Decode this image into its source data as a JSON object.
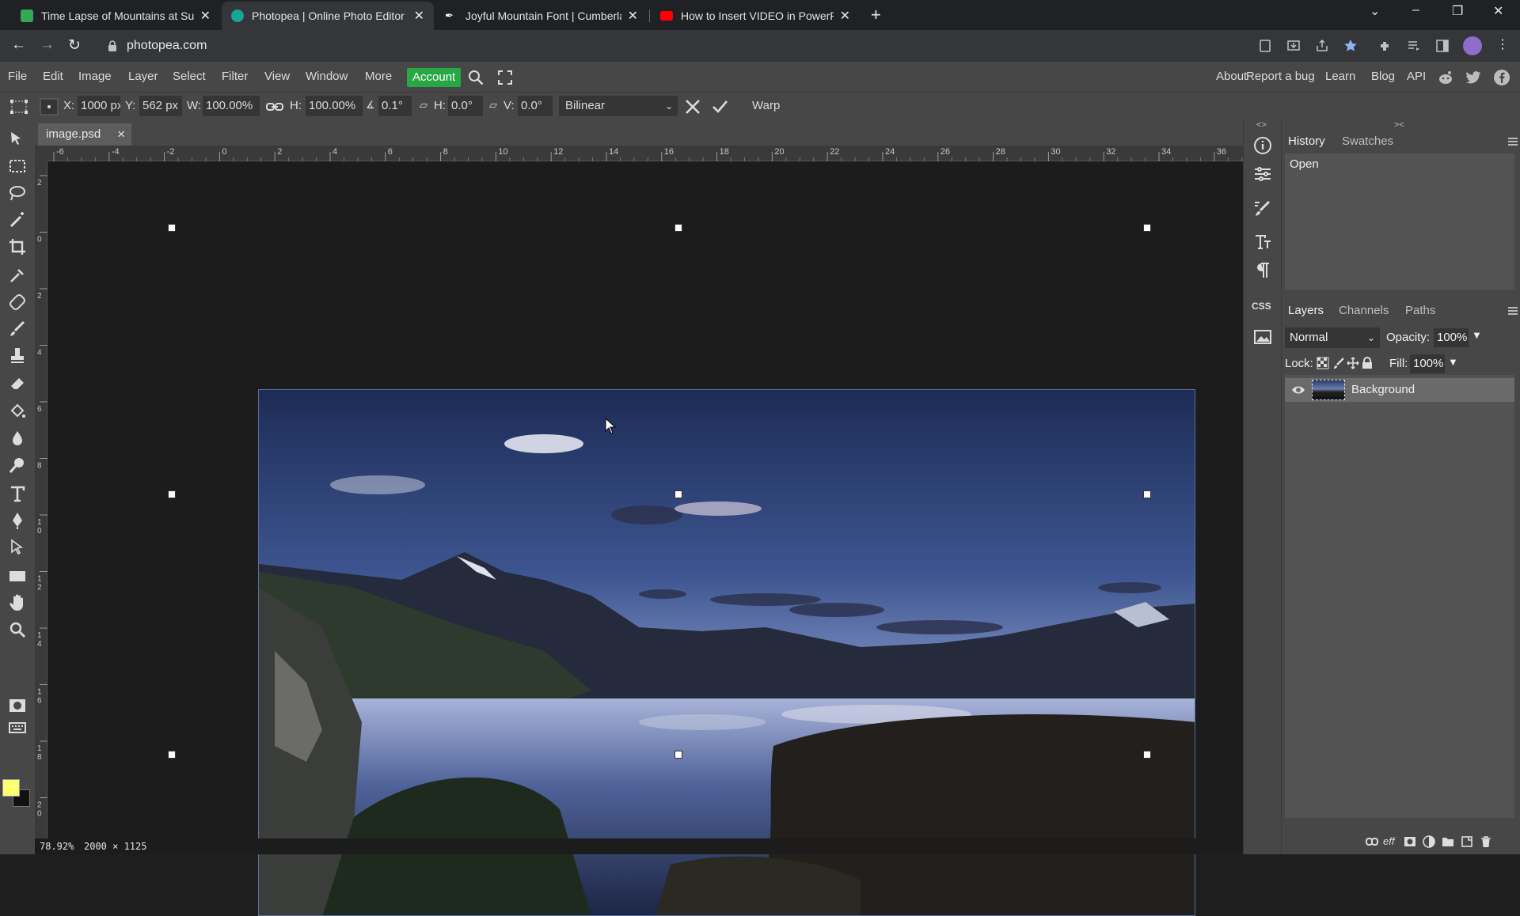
{
  "browser": {
    "tabs": [
      {
        "title": "Time Lapse of Mountains at Suns",
        "favicon_color": "#34a853",
        "active": false
      },
      {
        "title": "Photopea | Online Photo Editor",
        "favicon_color": "#18a497",
        "active": true
      },
      {
        "title": "Joyful Mountain Font | Cumberla",
        "favicon_color": "#ffffff",
        "active": false
      },
      {
        "title": "How to Insert VIDEO in PowerPoi",
        "favicon_color": "#ff0000",
        "active": false
      }
    ],
    "close_glyph": "✕",
    "new_tab_glyph": "+",
    "url": "photopea.com"
  },
  "menubar": {
    "items": [
      "File",
      "Edit",
      "Image",
      "Layer",
      "Select",
      "Filter",
      "View",
      "Window",
      "More"
    ],
    "account": "Account",
    "right_items": [
      "About",
      "Report a bug",
      "Learn",
      "Blog",
      "API"
    ]
  },
  "options": {
    "x_label": "X:",
    "x_value": "1000 px",
    "y_label": "Y:",
    "y_value": "562 px",
    "w_label": "W:",
    "w_value": "100.00%",
    "h_label": "H:",
    "h_value": "100.00%",
    "angle_value": "0.1°",
    "skew_h_label": "H:",
    "skew_h_value": "0.0°",
    "skew_v_label": "V:",
    "skew_v_value": "0.0°",
    "interpolation": "Bilinear",
    "warp": "Warp"
  },
  "document": {
    "tab_name": "image.psd",
    "zoom": "78.92%",
    "size": "2000 × 1125",
    "ruler_h": [
      "-6",
      "-4",
      "-2",
      "0",
      "2",
      "4",
      "6",
      "8",
      "10",
      "12",
      "14",
      "16",
      "18",
      "20",
      "22",
      "24",
      "26",
      "28",
      "30",
      "32",
      "34",
      "36"
    ],
    "ruler_v": [
      "2",
      "0",
      "2",
      "4",
      "6",
      "8",
      "1 0",
      "1 2",
      "1 4",
      "1 6",
      "1 8",
      "2 0"
    ]
  },
  "panels": {
    "top_tabs": [
      "History",
      "Swatches"
    ],
    "history_items": [
      "Open"
    ],
    "layer_tabs": [
      "Layers",
      "Channels",
      "Paths"
    ],
    "blend_mode": "Normal",
    "opacity_label": "Opacity:",
    "opacity_value": "100%",
    "lock_label": "Lock:",
    "fill_label": "Fill:",
    "fill_value": "100%",
    "layers": [
      {
        "name": "Background",
        "visible": true
      }
    ],
    "css_label": "CSS"
  },
  "colors": {
    "foreground": "#ffff73",
    "background": "#111111",
    "account_button": "#28a745"
  }
}
